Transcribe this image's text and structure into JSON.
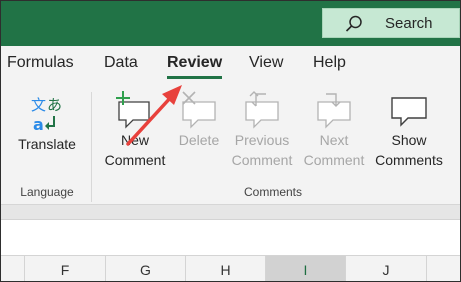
{
  "search": {
    "label": "Search",
    "icon": "search-icon"
  },
  "tabs": [
    {
      "label": "Formulas",
      "active": false
    },
    {
      "label": "Data",
      "active": false
    },
    {
      "label": "Review",
      "active": true
    },
    {
      "label": "View",
      "active": false
    },
    {
      "label": "Help",
      "active": false
    }
  ],
  "ribbon": {
    "language_group": {
      "label": "Language",
      "buttons": [
        {
          "label": "Translate",
          "icon": "translate-icon",
          "enabled": true
        }
      ]
    },
    "comments_group": {
      "label": "Comments",
      "buttons": [
        {
          "line1": "New",
          "line2": "Comment",
          "icon": "new-comment-icon",
          "enabled": true
        },
        {
          "line1": "Delete",
          "line2": "",
          "icon": "delete-comment-icon",
          "enabled": false
        },
        {
          "line1": "Previous",
          "line2": "Comment",
          "icon": "previous-comment-icon",
          "enabled": false
        },
        {
          "line1": "Next",
          "line2": "Comment",
          "icon": "next-comment-icon",
          "enabled": false
        },
        {
          "line1": "Show",
          "line2": "Comments",
          "icon": "show-comments-icon",
          "enabled": true
        }
      ]
    }
  },
  "columns": [
    {
      "label": "F",
      "selected": false
    },
    {
      "label": "G",
      "selected": false
    },
    {
      "label": "H",
      "selected": false
    },
    {
      "label": "I",
      "selected": true
    },
    {
      "label": "J",
      "selected": false
    }
  ],
  "colors": {
    "accent": "#217346",
    "search_bg": "#c6e8d3",
    "annotation_arrow": "#e8413c",
    "disabled_text": "#a6a6a6"
  }
}
